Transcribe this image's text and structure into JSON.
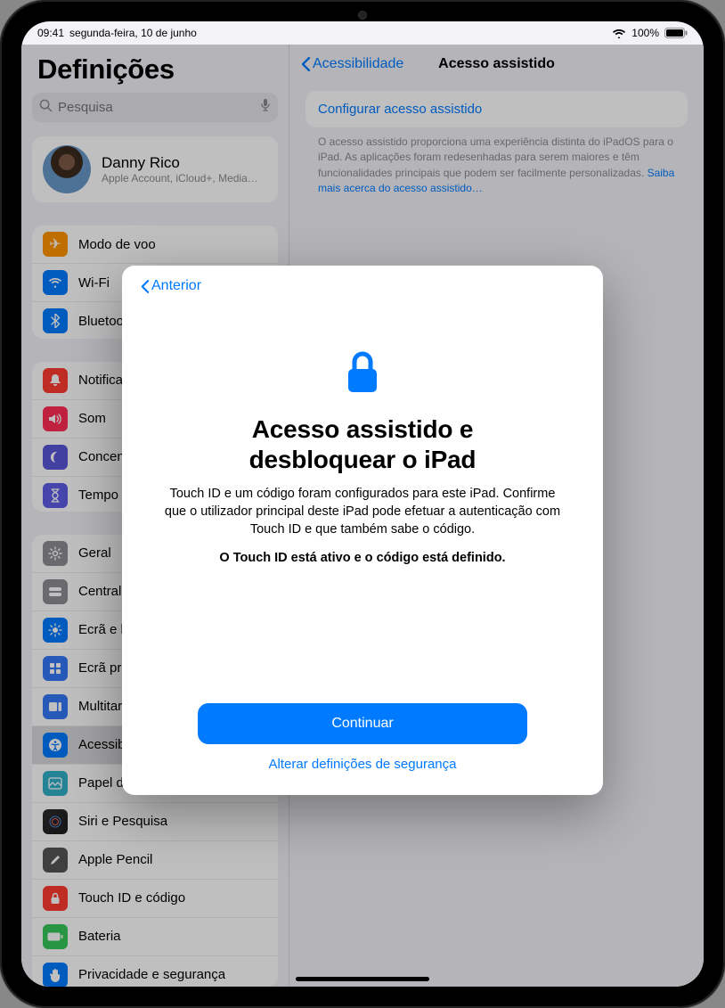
{
  "status": {
    "time": "09:41",
    "date": "segunda-feira, 10 de junho",
    "battery_pct": "100%"
  },
  "sidebar": {
    "title": "Definições",
    "search_placeholder": "Pesquisa",
    "account": {
      "name": "Danny Rico",
      "subtitle": "Apple Account, iCloud+, Media…"
    },
    "group1": [
      {
        "label": "Modo de voo"
      },
      {
        "label": "Wi-Fi"
      },
      {
        "label": "Bluetooth"
      }
    ],
    "group2": [
      {
        "label": "Notificações"
      },
      {
        "label": "Som"
      },
      {
        "label": "Concentração"
      },
      {
        "label": "Tempo de ecrã"
      }
    ],
    "group3": [
      {
        "label": "Geral"
      },
      {
        "label": "Central de controlo"
      },
      {
        "label": "Ecrã e brilho"
      },
      {
        "label": "Ecrã principal e App Library"
      },
      {
        "label": "Multitarefa e gestos"
      },
      {
        "label": "Acessibilidade"
      },
      {
        "label": "Papel de parede"
      },
      {
        "label": "Siri e Pesquisa"
      },
      {
        "label": "Apple Pencil"
      },
      {
        "label": "Touch ID e código"
      },
      {
        "label": "Bateria"
      },
      {
        "label": "Privacidade e segurança"
      }
    ]
  },
  "main": {
    "back_label": "Acessibilidade",
    "title": "Acesso assistido",
    "config_label": "Configurar acesso assistido",
    "footer": "O acesso assistido proporciona uma experiência distinta do iPadOS para o iPad. As aplicações foram redesenhadas para serem maiores e têm funcionalidades principais que podem ser facilmente personalizadas. ",
    "footer_link": "Saiba mais acerca do acesso assistido…"
  },
  "sheet": {
    "back_label": "Anterior",
    "title_line1": "Acesso assistido e",
    "title_line2": "desbloquear o iPad",
    "paragraph": "Touch ID e um código foram configurados para este iPad. Confirme que o utilizador principal deste iPad pode efetuar a autenticação com Touch ID e que também sabe o código.",
    "status_line": "O Touch ID está ativo e o código está definido.",
    "primary_button": "Continuar",
    "link_button": "Alterar definições de segurança"
  }
}
